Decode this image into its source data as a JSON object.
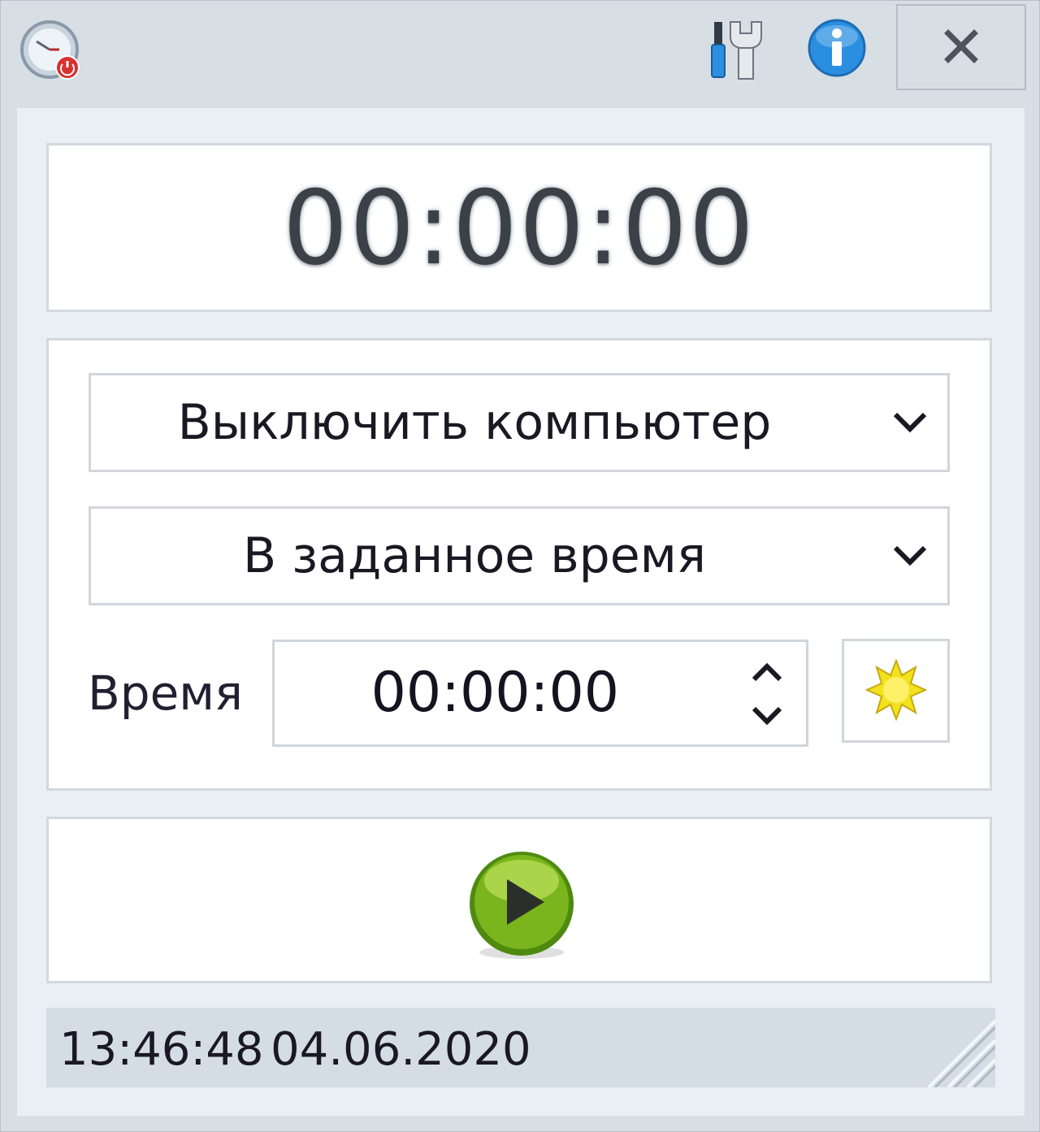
{
  "titlebar": {
    "app_icon": "shutdown-timer-clock-icon",
    "tools_icon": "screwdriver-wrench-icon",
    "info_icon": "info-icon",
    "close_icon": "close-icon"
  },
  "timer": {
    "countdown": "00:00:00"
  },
  "settings": {
    "action_select": {
      "value": "Выключить компьютер",
      "arrow_icon": "chevron-down-icon"
    },
    "mode_select": {
      "value": "В заданное время",
      "arrow_icon": "chevron-down-icon"
    },
    "time_label": "Время",
    "time_value": "00:00:00",
    "now_button_icon": "sun-icon"
  },
  "start": {
    "icon": "play-icon"
  },
  "status": {
    "time": "13:46:48",
    "date": "04.06.2020"
  },
  "colors": {
    "window_bg": "#d7dee4",
    "client_bg": "#e9eff4",
    "panel_border": "#d2d8de",
    "info_blue": "#2a8fe0",
    "play_green": "#7ab51d",
    "sun_yellow": "#f2e21b"
  }
}
